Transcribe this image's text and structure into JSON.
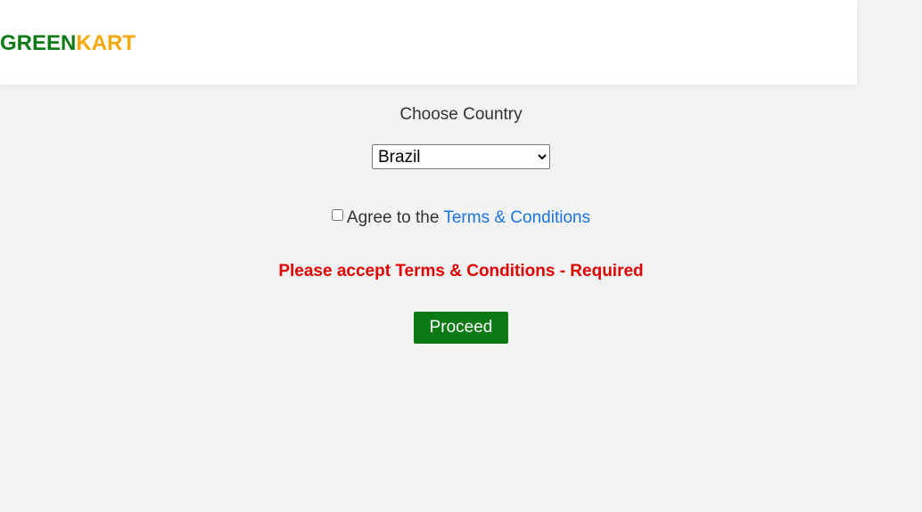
{
  "header": {
    "logo_part1": "GREEN",
    "logo_part2": "KART"
  },
  "form": {
    "choose_label": "Choose Country",
    "country_selected": "Brazil",
    "agree_prefix": "Agree to the ",
    "terms_link": "Terms & Conditions",
    "agree_checked": false,
    "error_message": "Please accept Terms & Conditions - Required",
    "proceed_label": "Proceed"
  },
  "colors": {
    "brand_green": "#0c7a14",
    "brand_orange": "#f6a800",
    "link_blue": "#1a73e8",
    "error_red": "#e00000",
    "background": "#f3f3f3"
  }
}
